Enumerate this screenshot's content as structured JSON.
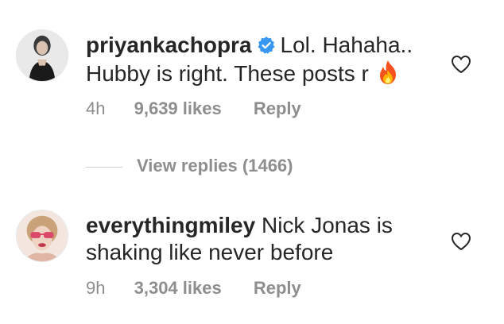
{
  "comments": [
    {
      "username": "priyankachopra",
      "verified": true,
      "line1": "Lol. Hahaha..",
      "line2": "Hubby is right. These posts r",
      "emoji": "fire-emoji",
      "time": "4h",
      "likes": "9,639 likes",
      "reply": "Reply",
      "avatar": "priyankachopra-avatar"
    },
    {
      "username": "everythingmiley",
      "verified": false,
      "line1": "Nick Jonas is",
      "line2": "shaking like never before",
      "time": "9h",
      "likes": "3,304 likes",
      "reply": "Reply",
      "avatar": "everythingmiley-avatar"
    }
  ],
  "view_replies": "View replies (1466)",
  "colors": {
    "text": "#262626",
    "meta": "#8e8e8e",
    "verified": "#3897f0",
    "heart_stroke": "#262626"
  },
  "icons": [
    "verified-badge-icon",
    "fire-emoji-icon",
    "heart-outline-icon"
  ]
}
